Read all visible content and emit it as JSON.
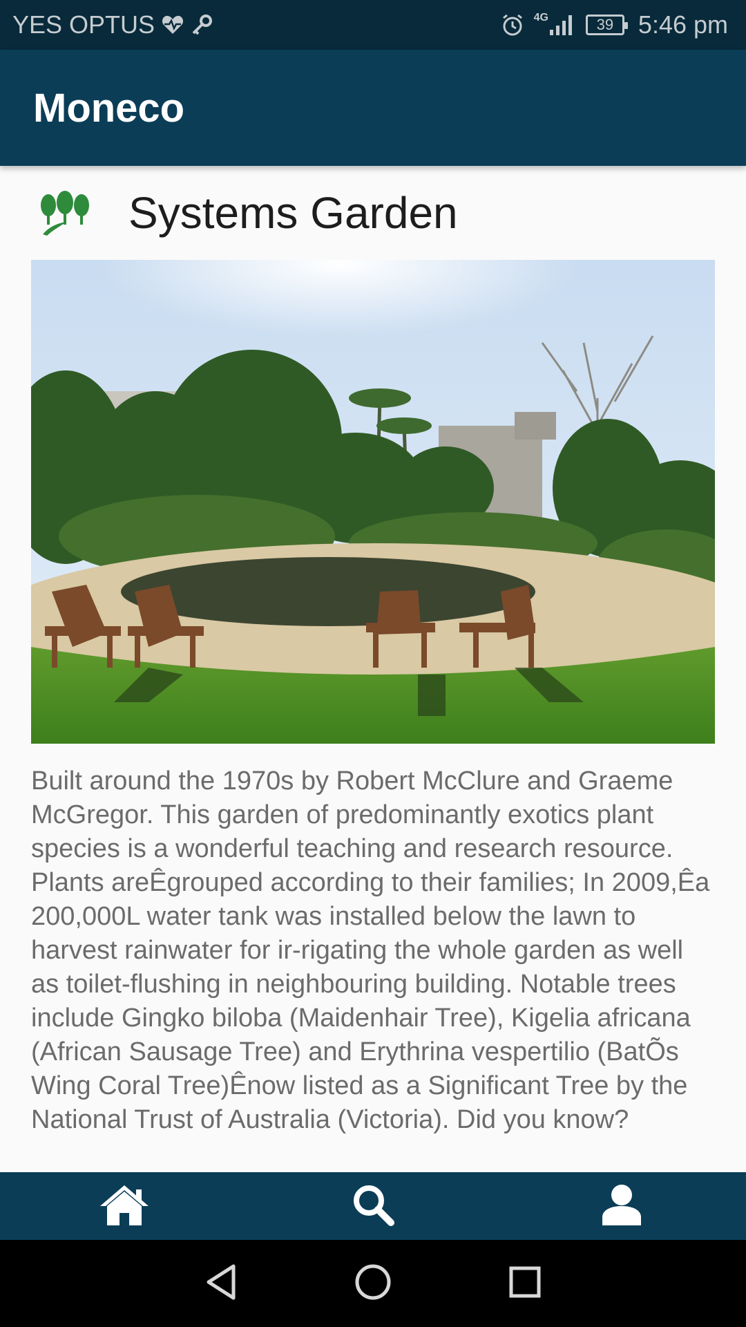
{
  "status_bar": {
    "carrier": "YES OPTUS",
    "network": "4G",
    "battery": "39",
    "time": "5:46 pm",
    "icons": [
      "heart-monitor-icon",
      "key-icon",
      "alarm-icon",
      "signal-icon",
      "battery-icon"
    ]
  },
  "app_bar": {
    "title": "Moneco"
  },
  "place": {
    "icon": "trees-icon",
    "title": "Systems Garden",
    "photo": "garden-pond-with-chairs",
    "description": "Built around the 1970s by Robert McClure and Graeme McGregor. This garden of predominantly exotics plant species is a wonderful teaching and research resource. Plants areÊgrouped according to their families; In 2009,Êa 200,000L water tank was installed below the lawn to harvest rainwater for ir-rigating the whole garden as well as toilet-flushing in neighbouring building. Notable trees include Gingko biloba (Maidenhair Tree), Kigelia africana (African Sausage Tree) and Erythrina vespertilio (BatÕs Wing Coral Tree)Ênow listed as a Significant Tree by the National Trust of Australia (Victoria). Did you know?"
  },
  "bottom_nav": {
    "items": [
      {
        "icon": "home-icon"
      },
      {
        "icon": "search-icon"
      },
      {
        "icon": "user-icon"
      }
    ]
  },
  "system_nav": {
    "items": [
      {
        "icon": "back-icon"
      },
      {
        "icon": "home-circle-icon"
      },
      {
        "icon": "recents-icon"
      }
    ]
  },
  "colors": {
    "status_bar_bg": "#082a3a",
    "primary": "#0b3d57",
    "tree_icon": "#2e8b3c",
    "body_text": "#6b6b6b"
  }
}
